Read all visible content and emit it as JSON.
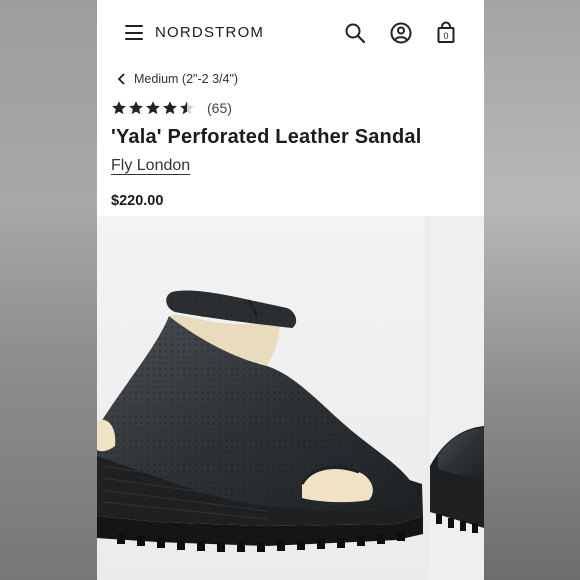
{
  "header": {
    "logo": "NORDSTROM",
    "bag_count": "0"
  },
  "breadcrumb": {
    "label": "Medium (2\"-2 3/4\")"
  },
  "rating": {
    "stars": 4.5,
    "count": "(65)"
  },
  "product": {
    "title": "'Yala' Perforated Leather Sandal",
    "brand": "Fly London",
    "price": "$220.00"
  },
  "icons": [
    "menu-icon",
    "search-icon",
    "account-icon",
    "shopping-bag-icon",
    "chevron-left-icon",
    "star-icon"
  ],
  "colors": {
    "text": "#1b1b1b",
    "shoe": "#2f3336",
    "page_bg": "#ffffff"
  }
}
